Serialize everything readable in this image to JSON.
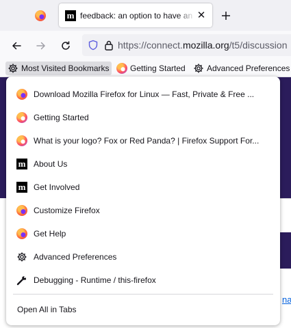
{
  "tabs": {
    "active_title": "feedback: an option to have an",
    "close_glyph": "✕",
    "new_tab_glyph": "+"
  },
  "navbar": {
    "url_prefix": "https://connect.",
    "url_host": "mozilla.org",
    "url_path": "/t5/discussion"
  },
  "bookmarks_toolbar": {
    "items": [
      {
        "label": "Most Visited Bookmarks",
        "icon": "gear-icon"
      },
      {
        "label": "Getting Started",
        "icon": "firefox-icon"
      },
      {
        "label": "Advanced Preferences",
        "icon": "gear-icon"
      }
    ]
  },
  "menu": {
    "items": [
      {
        "label": "Download Mozilla Firefox for Linux — Fast, Private & Free ...",
        "icon": "firefox-icon"
      },
      {
        "label": "Getting Started",
        "icon": "firefox-icon"
      },
      {
        "label": "What is your logo? Fox or Red Panda? | Firefox Support For...",
        "icon": "firefox-icon"
      },
      {
        "label": "About Us",
        "icon": "mozilla-m-icon"
      },
      {
        "label": "Get Involved",
        "icon": "mozilla-m-icon"
      },
      {
        "label": "Customize Firefox",
        "icon": "firefox-icon"
      },
      {
        "label": "Get Help",
        "icon": "firefox-icon"
      },
      {
        "label": "Advanced Preferences",
        "icon": "gear-icon"
      },
      {
        "label": "Debugging - Runtime / this-firefox",
        "icon": "wrench-icon"
      }
    ],
    "open_all": "Open All in Tabs"
  },
  "page": {
    "edge_link": "na"
  },
  "colors": {
    "accent": "#0060df",
    "page_purple": "#2b1c5b",
    "toolbar_bg": "#f9f9fb",
    "tabstrip_bg": "#f0f0f4"
  }
}
